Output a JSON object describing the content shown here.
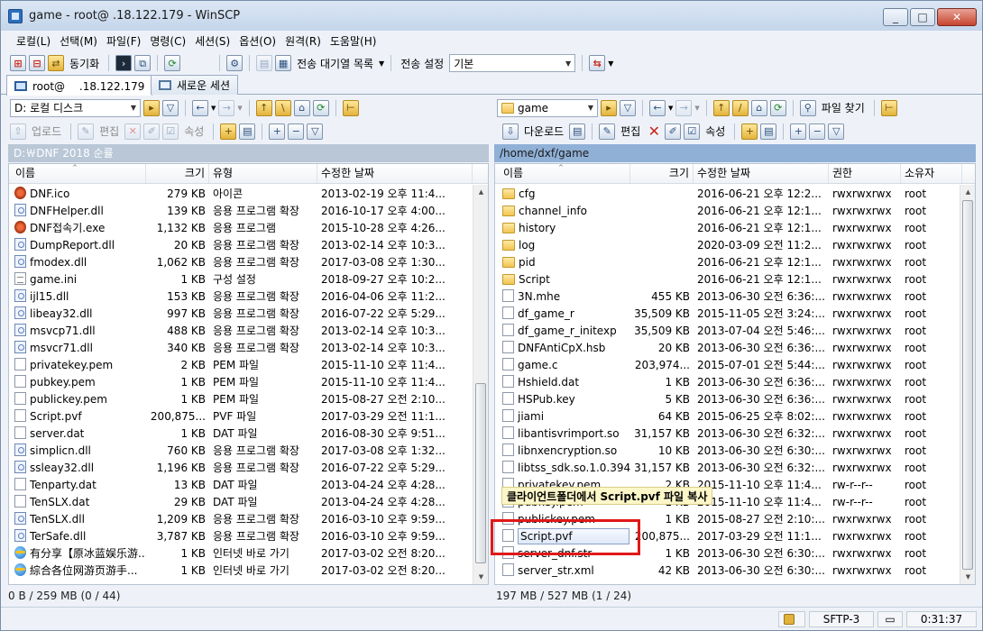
{
  "window": {
    "title": "game - root@ .18.122.179 - WinSCP",
    "buttons": [
      "_",
      "□",
      "✕"
    ]
  },
  "menu": [
    "로컬(L)",
    "선택(M)",
    "파일(F)",
    "명령(C)",
    "세션(S)",
    "옵션(O)",
    "원격(R)",
    "도움말(H)"
  ],
  "toolbar": {
    "sync_label": "동기화",
    "queue_label": "전송 대기열 목록",
    "transfer_settings_label": "전송 설정",
    "transfer_preset": "기본"
  },
  "tabs": [
    {
      "label": "root@　 .18.122.179"
    },
    {
      "label": "새로운 세션"
    }
  ],
  "left": {
    "drive": "D: 로컬 디스크",
    "actions": {
      "upload": "업로드",
      "edit": "편집",
      "properties": "속성"
    },
    "path": "D:￦DNF 2018 순률",
    "columns": [
      "이름",
      "크기",
      "유형",
      "수정한 날짜"
    ],
    "files": [
      {
        "icon": "exe",
        "name": "DNF.ico",
        "size": "279 KB",
        "type": "아이콘",
        "date": "2013-02-19  오후 11:4..."
      },
      {
        "icon": "dll",
        "name": "DNFHelper.dll",
        "size": "139 KB",
        "type": "응용 프로그램 확장",
        "date": "2016-10-17  오후 4:00..."
      },
      {
        "icon": "exe",
        "name": "DNF접속기.exe",
        "size": "1,132 KB",
        "type": "응용 프로그램",
        "date": "2015-10-28  오후 4:26..."
      },
      {
        "icon": "dll",
        "name": "DumpReport.dll",
        "size": "20 KB",
        "type": "응용 프로그램 확장",
        "date": "2013-02-14  오후 10:3..."
      },
      {
        "icon": "dll",
        "name": "fmodex.dll",
        "size": "1,062 KB",
        "type": "응용 프로그램 확장",
        "date": "2017-03-08  오후 1:30..."
      },
      {
        "icon": "ini",
        "name": "game.ini",
        "size": "1 KB",
        "type": "구성 설정",
        "date": "2018-09-27  오후 10:2..."
      },
      {
        "icon": "dll",
        "name": "ijl15.dll",
        "size": "153 KB",
        "type": "응용 프로그램 확장",
        "date": "2016-04-06  오후 11:2..."
      },
      {
        "icon": "dll",
        "name": "libeay32.dll",
        "size": "997 KB",
        "type": "응용 프로그램 확장",
        "date": "2016-07-22  오후 5:29..."
      },
      {
        "icon": "dll",
        "name": "msvcp71.dll",
        "size": "488 KB",
        "type": "응용 프로그램 확장",
        "date": "2013-02-14  오후 10:3..."
      },
      {
        "icon": "dll",
        "name": "msvcr71.dll",
        "size": "340 KB",
        "type": "응용 프로그램 확장",
        "date": "2013-02-14  오후 10:3..."
      },
      {
        "icon": "file",
        "name": "privatekey.pem",
        "size": "2 KB",
        "type": "PEM 파일",
        "date": "2015-11-10  오후 11:4..."
      },
      {
        "icon": "file",
        "name": "pubkey.pem",
        "size": "1 KB",
        "type": "PEM 파일",
        "date": "2015-11-10  오후 11:4..."
      },
      {
        "icon": "file",
        "name": "publickey.pem",
        "size": "1 KB",
        "type": "PEM 파일",
        "date": "2015-08-27  오전 2:10..."
      },
      {
        "icon": "file",
        "name": "Script.pvf",
        "size": "200,875...",
        "type": "PVF 파일",
        "date": "2017-03-29  오전 11:1..."
      },
      {
        "icon": "file",
        "name": "server.dat",
        "size": "1 KB",
        "type": "DAT 파일",
        "date": "2016-08-30  오후 9:51..."
      },
      {
        "icon": "dll",
        "name": "simplicn.dll",
        "size": "760 KB",
        "type": "응용 프로그램 확장",
        "date": "2017-03-08  오후 1:32..."
      },
      {
        "icon": "dll",
        "name": "ssleay32.dll",
        "size": "1,196 KB",
        "type": "응용 프로그램 확장",
        "date": "2016-07-22  오후 5:29..."
      },
      {
        "icon": "file",
        "name": "Tenparty.dat",
        "size": "13 KB",
        "type": "DAT 파일",
        "date": "2013-04-24  오후 4:28..."
      },
      {
        "icon": "file",
        "name": "TenSLX.dat",
        "size": "29 KB",
        "type": "DAT 파일",
        "date": "2013-04-24  오후 4:28..."
      },
      {
        "icon": "dll",
        "name": "TenSLX.dll",
        "size": "1,209 KB",
        "type": "응용 프로그램 확장",
        "date": "2016-03-10  오후 9:59..."
      },
      {
        "icon": "dll",
        "name": "TerSafe.dll",
        "size": "3,787 KB",
        "type": "응용 프로그램 확장",
        "date": "2016-03-10  오후 9:59..."
      },
      {
        "icon": "url",
        "name": "有分享【原冰蓝娱乐游...",
        "size": "1 KB",
        "type": "인터넷 바로 가기",
        "date": "2017-03-02  오전 8:20..."
      },
      {
        "icon": "url",
        "name": "綜合各位网游页游手...",
        "size": "1 KB",
        "type": "인터넷 바로 가기",
        "date": "2017-03-02  오전 8:20..."
      }
    ],
    "status": "0 B / 259 MB (0 / 44)"
  },
  "right": {
    "folder": "game",
    "actions": {
      "download": "다운로드",
      "edit": "편집",
      "properties": "속성",
      "find": "파일 찾기"
    },
    "path": "/home/dxf/game",
    "columns": [
      "이름",
      "크기",
      "수정한 날짜",
      "권한",
      "소유자"
    ],
    "files": [
      {
        "icon": "folder",
        "name": "cfg",
        "size": "",
        "date": "2016-06-21  오후 12:2...",
        "perm": "rwxrwxrwx",
        "owner": "root"
      },
      {
        "icon": "folder",
        "name": "channel_info",
        "size": "",
        "date": "2016-06-21  오후 12:1...",
        "perm": "rwxrwxrwx",
        "owner": "root"
      },
      {
        "icon": "folder",
        "name": "history",
        "size": "",
        "date": "2016-06-21  오후 12:1...",
        "perm": "rwxrwxrwx",
        "owner": "root"
      },
      {
        "icon": "folder",
        "name": "log",
        "size": "",
        "date": "2020-03-09  오전 11:2...",
        "perm": "rwxrwxrwx",
        "owner": "root"
      },
      {
        "icon": "folder",
        "name": "pid",
        "size": "",
        "date": "2016-06-21  오후 12:1...",
        "perm": "rwxrwxrwx",
        "owner": "root"
      },
      {
        "icon": "folder",
        "name": "Script",
        "size": "",
        "date": "2016-06-21  오후 12:1...",
        "perm": "rwxrwxrwx",
        "owner": "root"
      },
      {
        "icon": "file",
        "name": "3N.mhe",
        "size": "455 KB",
        "date": "2013-06-30  오전 6:36:...",
        "perm": "rwxrwxrwx",
        "owner": "root"
      },
      {
        "icon": "file",
        "name": "df_game_r",
        "size": "35,509 KB",
        "date": "2015-11-05  오전 3:24:...",
        "perm": "rwxrwxrwx",
        "owner": "root"
      },
      {
        "icon": "file",
        "name": "df_game_r_initexp",
        "size": "35,509 KB",
        "date": "2013-07-04  오전 5:46:...",
        "perm": "rwxrwxrwx",
        "owner": "root"
      },
      {
        "icon": "file",
        "name": "DNFAntiCpX.hsb",
        "size": "20 KB",
        "date": "2013-06-30  오전 6:36:...",
        "perm": "rwxrwxrwx",
        "owner": "root"
      },
      {
        "icon": "file",
        "name": "game.c",
        "size": "203,974...",
        "date": "2015-07-01  오전 5:44:...",
        "perm": "rwxrwxrwx",
        "owner": "root"
      },
      {
        "icon": "file",
        "name": "Hshield.dat",
        "size": "1 KB",
        "date": "2013-06-30  오전 6:36:...",
        "perm": "rwxrwxrwx",
        "owner": "root"
      },
      {
        "icon": "file",
        "name": "HSPub.key",
        "size": "5 KB",
        "date": "2013-06-30  오전 6:36:...",
        "perm": "rwxrwxrwx",
        "owner": "root"
      },
      {
        "icon": "file",
        "name": "jiami",
        "size": "64 KB",
        "date": "2015-06-25  오후 8:02:...",
        "perm": "rwxrwxrwx",
        "owner": "root"
      },
      {
        "icon": "file",
        "name": "libantisvrimport.so",
        "size": "31,157 KB",
        "date": "2013-06-30  오전 6:32:...",
        "perm": "rwxrwxrwx",
        "owner": "root"
      },
      {
        "icon": "file",
        "name": "libnxencryption.so",
        "size": "10 KB",
        "date": "2013-06-30  오전 6:30:...",
        "perm": "rwxrwxrwx",
        "owner": "root"
      },
      {
        "icon": "file",
        "name": "libtss_sdk.so.1.0.394",
        "size": "31,157 KB",
        "date": "2013-06-30  오전 6:32:...",
        "perm": "rwxrwxrwx",
        "owner": "root"
      },
      {
        "icon": "file",
        "name": "privatekey.pem",
        "size": "2 KB",
        "date": "2015-11-10  오후 11:4...",
        "perm": "rw-r--r--",
        "owner": "root"
      },
      {
        "icon": "file",
        "name": "pubkey.pem",
        "size": "1 KB",
        "date": "2015-11-10  오후 11:4...",
        "perm": "rw-r--r--",
        "owner": "root"
      },
      {
        "icon": "file",
        "name": "publickey.pem",
        "size": "1 KB",
        "date": "2015-08-27  오전 2:10:...",
        "perm": "rwxrwxrwx",
        "owner": "root"
      },
      {
        "icon": "file",
        "name": "Script.pvf",
        "size": "200,875...",
        "date": "2017-03-29  오전 11:1...",
        "perm": "rwxrwxrwx",
        "owner": "root",
        "editing": true
      },
      {
        "icon": "file",
        "name": "server_dnf.str",
        "size": "1 KB",
        "date": "2013-06-30  오전 6:30:...",
        "perm": "rwxrwxrwx",
        "owner": "root"
      },
      {
        "icon": "file",
        "name": "server_str.xml",
        "size": "42 KB",
        "date": "2013-06-30  오전 6:30:...",
        "perm": "rwxrwxrwx",
        "owner": "root"
      }
    ],
    "status": "197 MB / 527 MB (1 / 24)"
  },
  "tooltip": "클라이언트폴더에서 Script.pvf 파일 복사",
  "statusbar": {
    "protocol": "SFTP-3",
    "time": "0:31:37"
  }
}
